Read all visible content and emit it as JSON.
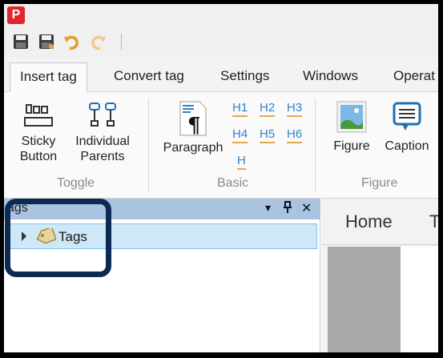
{
  "app": {
    "logo_letter": "P"
  },
  "tabs": [
    {
      "label": "Insert tag",
      "active": true
    },
    {
      "label": "Convert tag",
      "active": false
    },
    {
      "label": "Settings",
      "active": false
    },
    {
      "label": "Windows",
      "active": false
    },
    {
      "label": "Operat",
      "active": false
    }
  ],
  "ribbon": {
    "toggle_group": {
      "label": "Toggle",
      "sticky": [
        "Sticky",
        "Button"
      ],
      "parents": [
        "Individual",
        "Parents"
      ]
    },
    "basic_group": {
      "label": "Basic",
      "paragraph": "Paragraph",
      "headings": [
        "H1",
        "H2",
        "H3",
        "H4",
        "H5",
        "H6",
        "H"
      ]
    },
    "figure_group": {
      "label": "Figure",
      "figure": "Figure",
      "caption": "Caption"
    }
  },
  "tags_pane": {
    "title": "ags",
    "controls": {
      "dropdown": "▾",
      "pin": "📌",
      "close": "✕"
    },
    "tree": [
      {
        "label": "Tags",
        "expanded": false
      }
    ]
  },
  "document": {
    "tabs": [
      "Home",
      "T"
    ]
  },
  "colors": {
    "accent_highlight": "#0d2a55",
    "pane_header": "#a8c4e0",
    "selected_row": "#cfe8f7",
    "heading_blue": "#2f83c9",
    "heading_underline": "#e5a94b"
  }
}
